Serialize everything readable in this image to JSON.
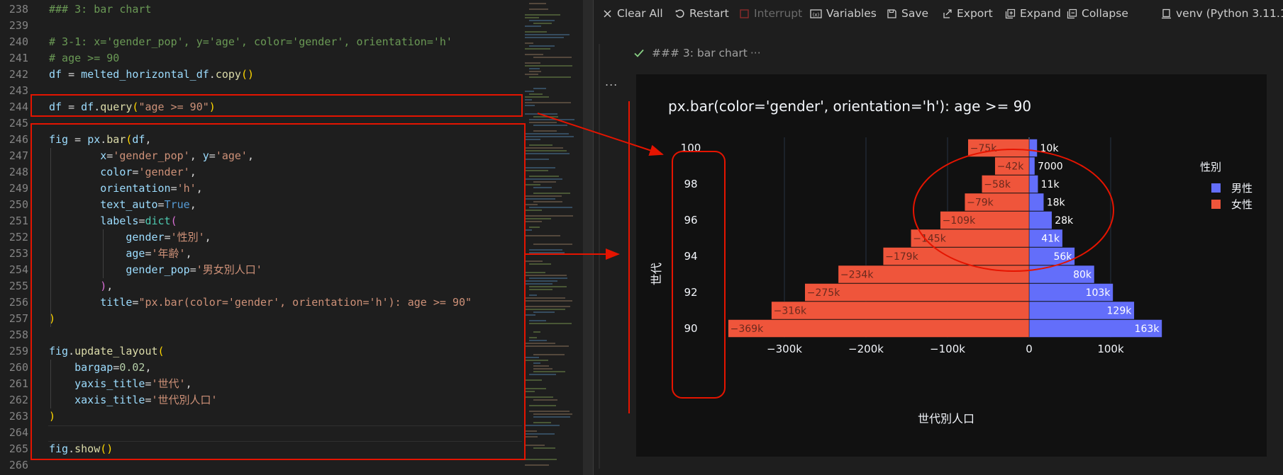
{
  "editor": {
    "lines": [
      {
        "n": "238",
        "html": "<span class=\"cmt\">### 3: bar chart</span>"
      },
      {
        "n": "239",
        "html": ""
      },
      {
        "n": "240",
        "html": "<span class=\"cmt\"># 3-1: x='gender_pop', y='age', color='gender', orientation='h'</span>"
      },
      {
        "n": "241",
        "html": "<span class=\"cmt\"># age &gt;= 90</span>"
      },
      {
        "n": "242",
        "html": "<span class=\"var\">df</span> = <span class=\"var\">melted_horizontal_df</span>.<span class=\"kw\">copy</span><span class=\"par\">()</span>"
      },
      {
        "n": "243",
        "html": ""
      },
      {
        "n": "244",
        "html": "<span class=\"var\">df</span> = <span class=\"var\">df</span>.<span class=\"kw\">query</span><span class=\"par\">(</span><span class=\"str\">\"age &gt;= 90\"</span><span class=\"par\">)</span>"
      },
      {
        "n": "245",
        "html": ""
      },
      {
        "n": "246",
        "html": "<span class=\"var\">fig</span> = <span class=\"var\">px</span>.<span class=\"kw\">bar</span><span class=\"par\">(</span><span class=\"var\">df</span>,"
      },
      {
        "n": "247",
        "html": "        <span class=\"var\">x</span>=<span class=\"str\">'gender_pop'</span>, <span class=\"var\">y</span>=<span class=\"str\">'age'</span>,"
      },
      {
        "n": "248",
        "html": "        <span class=\"var\">color</span>=<span class=\"str\">'gender'</span>,"
      },
      {
        "n": "249",
        "html": "        <span class=\"var\">orientation</span>=<span class=\"str\">'h'</span>,"
      },
      {
        "n": "250",
        "html": "        <span class=\"var\">text_auto</span>=<span class=\"bool\">True</span>,"
      },
      {
        "n": "251",
        "html": "        <span class=\"var\">labels</span>=<span class=\"cls\">dict</span><span class=\"par2\">(</span>"
      },
      {
        "n": "252",
        "html": "            <span class=\"var\">gender</span>=<span class=\"str\">'性別'</span>,"
      },
      {
        "n": "253",
        "html": "            <span class=\"var\">age</span>=<span class=\"str\">'年齢'</span>,"
      },
      {
        "n": "254",
        "html": "            <span class=\"var\">gender_pop</span>=<span class=\"str\">'男女別人口'</span>"
      },
      {
        "n": "255",
        "html": "        <span class=\"par2\">)</span>,"
      },
      {
        "n": "256",
        "html": "        <span class=\"var\">title</span>=<span class=\"str\">\"px.bar(color='gender', orientation='h'): age &gt;= 90\"</span>"
      },
      {
        "n": "257",
        "html": "<span class=\"par\">)</span>"
      },
      {
        "n": "258",
        "html": ""
      },
      {
        "n": "259",
        "html": "<span class=\"var\">fig</span>.<span class=\"kw\">update_layout</span><span class=\"par\">(</span>"
      },
      {
        "n": "260",
        "html": "    <span class=\"var\">bargap</span>=<span class=\"num\">0.02</span>,"
      },
      {
        "n": "261",
        "html": "    <span class=\"var\">yaxis_title</span>=<span class=\"str\">'世代'</span>,"
      },
      {
        "n": "262",
        "html": "    <span class=\"var\">xaxis_title</span>=<span class=\"str\">'世代別人口'</span>"
      },
      {
        "n": "263",
        "html": "<span class=\"par\">)</span>"
      },
      {
        "n": "264",
        "html": ""
      },
      {
        "n": "265",
        "html": "<span class=\"var\">fig</span>.<span class=\"kw\">show</span><span class=\"par\">()</span>"
      },
      {
        "n": "266",
        "html": ""
      }
    ]
  },
  "toolbar": {
    "clear_all": "Clear All",
    "restart": "Restart",
    "interrupt": "Interrupt",
    "variables": "Variables",
    "save": "Save",
    "export": "Export",
    "expand": "Expand",
    "collapse": "Collapse",
    "kernel": "venv (Python 3.11.1)"
  },
  "output": {
    "cell_header": "### 3: bar chart",
    "ellipsis": "...",
    "more": "···"
  },
  "colors": {
    "male": "#636efa",
    "female": "#ef553b",
    "annotation": "#e51400"
  },
  "chart_data": {
    "type": "bar",
    "orientation": "h",
    "title": "px.bar(color='gender', orientation='h'): age >= 90",
    "xlabel": "世代別人口",
    "ylabel": "世代",
    "legend_title": "性別",
    "legend_position": "top-right",
    "categories": [
      90,
      91,
      92,
      93,
      94,
      95,
      96,
      97,
      98,
      99,
      100
    ],
    "y_tick_labels": [
      "90",
      "92",
      "94",
      "96",
      "98",
      "100"
    ],
    "x_tick_labels": [
      "−300k",
      "−200k",
      "−100k",
      "0",
      "100k"
    ],
    "xlim": [
      -369000,
      163000
    ],
    "series": [
      {
        "name": "男性",
        "values": [
          163000,
          129000,
          103000,
          80000,
          56000,
          41000,
          28000,
          18000,
          11000,
          7000,
          10000
        ],
        "labels": [
          "163k",
          "129k",
          "103k",
          "80k",
          "56k",
          "41k",
          "28k",
          "18k",
          "11k",
          "7000",
          "10k"
        ]
      },
      {
        "name": "女性",
        "values": [
          -369000,
          -316000,
          -275000,
          -234000,
          -179000,
          -145000,
          -109000,
          -79000,
          -58000,
          -42000,
          -75000
        ],
        "labels": [
          "−369k",
          "−316k",
          "−275k",
          "−234k",
          "−179k",
          "−145k",
          "−109k",
          "−79k",
          "−58k",
          "−42k",
          "−75k"
        ]
      }
    ]
  }
}
